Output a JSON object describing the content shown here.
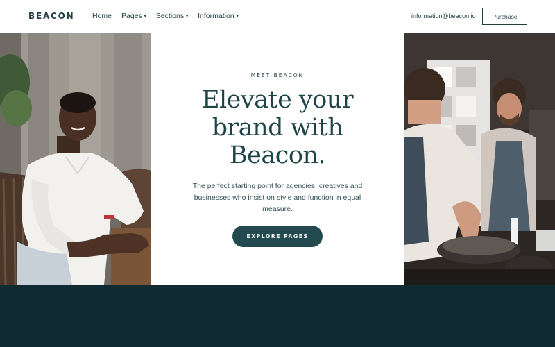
{
  "nav": {
    "logo": "BEACON",
    "links": [
      {
        "label": "Home",
        "has_dropdown": false
      },
      {
        "label": "Pages",
        "has_dropdown": true
      },
      {
        "label": "Sections",
        "has_dropdown": true
      },
      {
        "label": "Information",
        "has_dropdown": true
      }
    ],
    "email": "information@beacon.io",
    "purchase_label": "Purchase"
  },
  "hero": {
    "eyebrow": "MEET BEACON",
    "title": "Elevate your brand with Beacon.",
    "description": "The perfect starting point for agencies, creatives and businesses who insist on style and function in equal measure.",
    "cta_label": "EXPLORE PAGES"
  },
  "colors": {
    "accent": "#1f3f45",
    "button": "#234b4f",
    "footer": "#0f2a30"
  },
  "icons": {
    "dropdown": "chevron-down-icon"
  }
}
